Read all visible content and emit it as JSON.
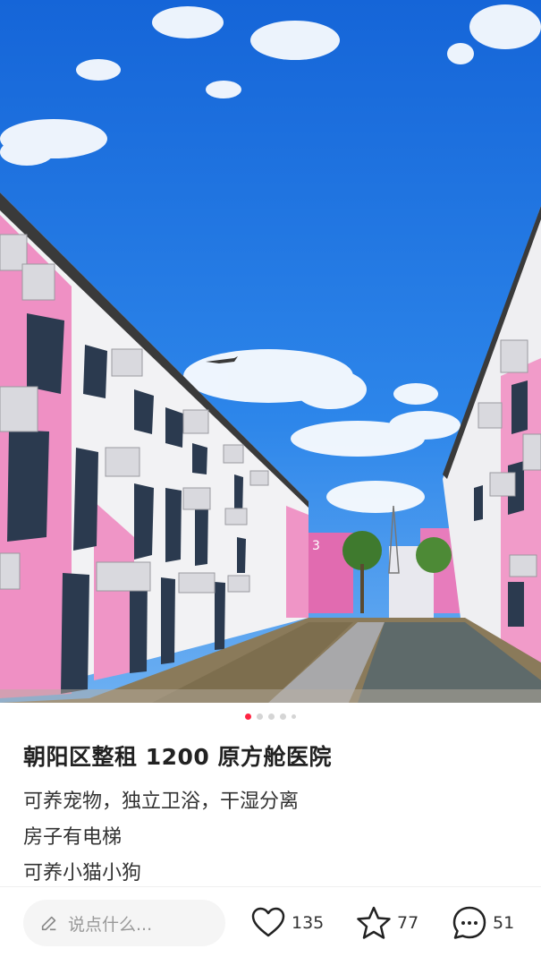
{
  "post": {
    "title": "朝阳区整租 1200 原方舱医院",
    "description": [
      "可养宠物，独立卫浴，干湿分离",
      "房子有电梯",
      "可养小猫小狗"
    ]
  },
  "carousel": {
    "total": 5,
    "active_index": 0
  },
  "photo": {
    "building_label": "3"
  },
  "bottom_bar": {
    "comment_placeholder": "说点什么...",
    "likes": "135",
    "favorites": "77",
    "comments": "51"
  },
  "colors": {
    "accent": "#ff2442",
    "sky": "#1f78e6",
    "building_pink": "#ef8ec2"
  },
  "icons": [
    "pen-icon",
    "heart-icon",
    "star-icon",
    "comment-icon"
  ]
}
